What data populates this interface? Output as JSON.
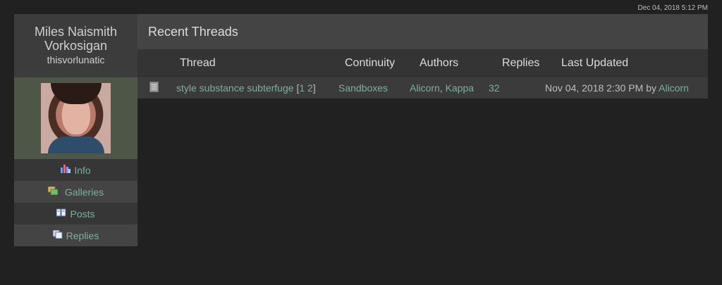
{
  "timestamp": "Dec 04, 2018 5:12 PM",
  "profile": {
    "name": "Miles Naismith Vorkosigan",
    "username": "thisvorlunatic"
  },
  "sidebar": {
    "items": [
      {
        "label": "Info",
        "icon": "chart-icon"
      },
      {
        "label": "Galleries",
        "icon": "gallery-icon"
      },
      {
        "label": "Posts",
        "icon": "book-icon"
      },
      {
        "label": "Replies",
        "icon": "pages-icon"
      }
    ]
  },
  "main": {
    "title": "Recent Threads",
    "columns": {
      "thread": "Thread",
      "continuity": "Continuity",
      "authors": "Authors",
      "replies": "Replies",
      "last_updated": "Last Updated"
    },
    "rows": [
      {
        "thread": "style substance subterfuge",
        "page_open": "[",
        "page_1": "1",
        "page_2": "2",
        "page_close": "]",
        "continuity": "Sandboxes",
        "author_1": "Alicorn",
        "author_sep": ",",
        "author_2": "Kappa",
        "replies": "32",
        "last_updated": "Nov 04, 2018 2:30 PM",
        "by": "by",
        "last_author": "Alicorn"
      }
    ]
  },
  "colors": {
    "background": "#212121",
    "link": "#7ab09a",
    "panel": "#444444"
  }
}
